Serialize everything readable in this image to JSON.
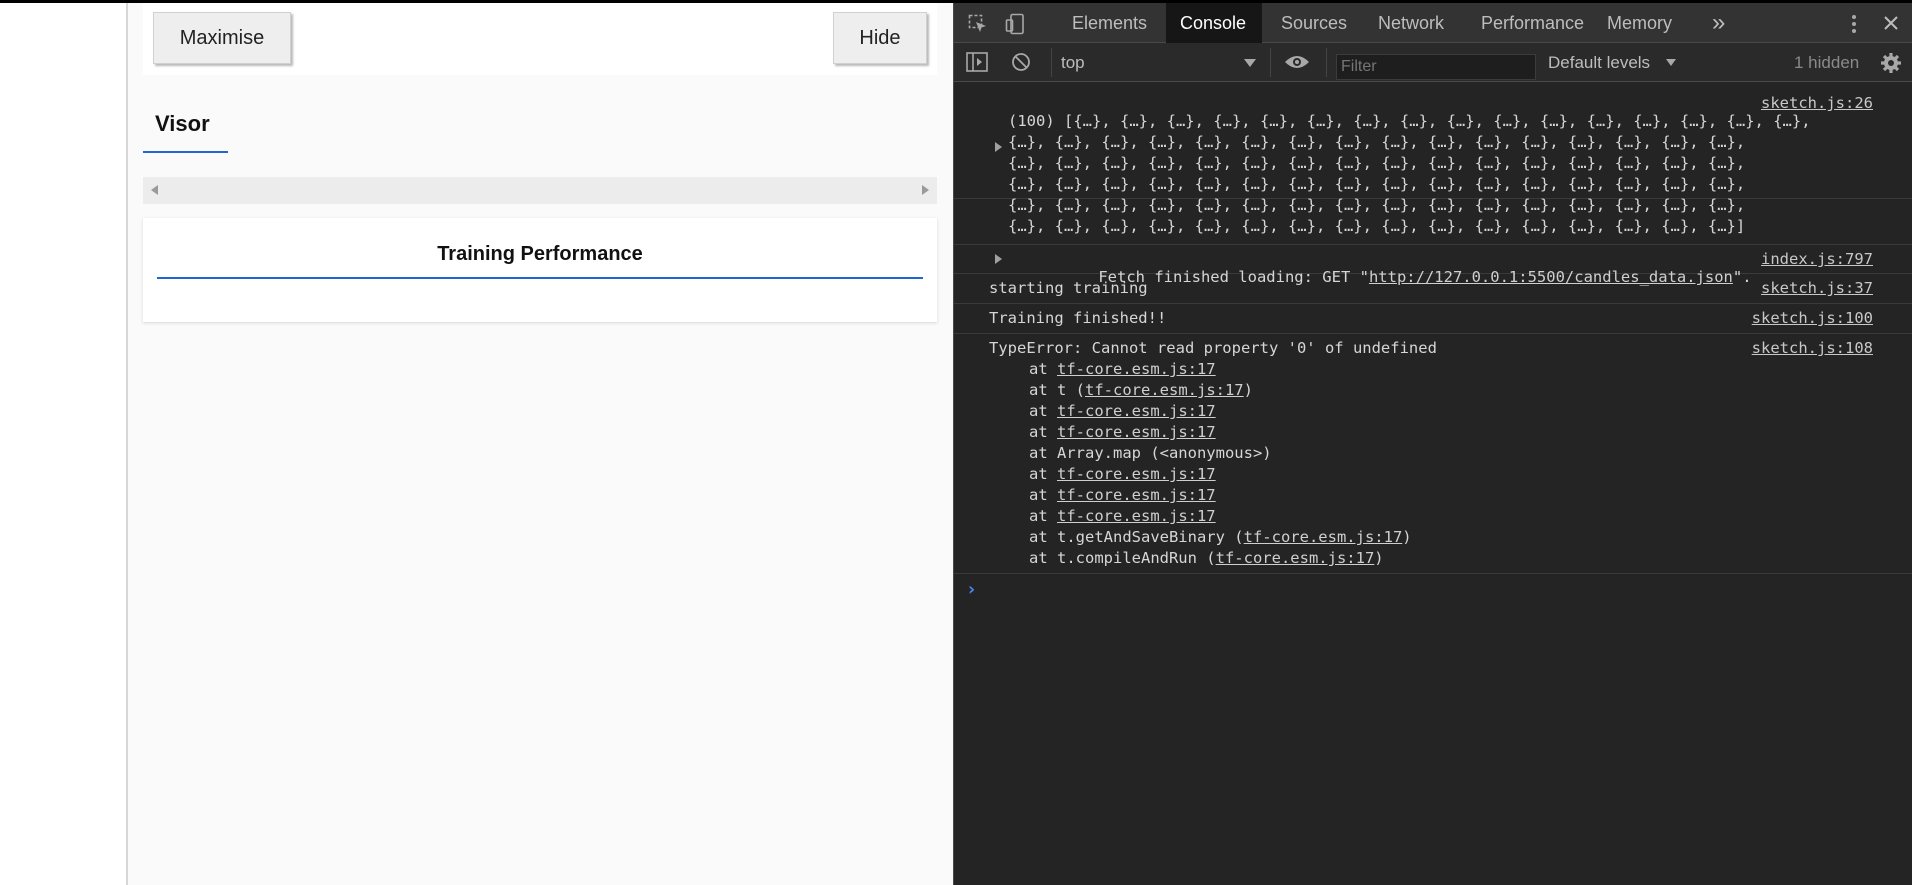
{
  "visor": {
    "maximise_label": "Maximise",
    "hide_label": "Hide",
    "tab_label": "Visor",
    "card_title": "Training Performance"
  },
  "devtools": {
    "tabs": [
      "Elements",
      "Console",
      "Sources",
      "Network",
      "Performance",
      "Memory"
    ],
    "overflow_glyph": "»",
    "toolbar": {
      "context": "top",
      "filter_placeholder": "Filter",
      "levels": "Default levels",
      "hidden": "1 hidden"
    },
    "console": {
      "array_lines": [
        "(100) [{…}, {…}, {…}, {…}, {…}, {…}, {…}, {…}, {…}, {…}, {…}, {…}, {…}, {…}, {…}, {…},",
        "{…}, {…}, {…}, {…}, {…}, {…}, {…}, {…}, {…}, {…}, {…}, {…}, {…}, {…}, {…}, {…},",
        "{…}, {…}, {…}, {…}, {…}, {…}, {…}, {…}, {…}, {…}, {…}, {…}, {…}, {…}, {…}, {…},",
        "{…}, {…}, {…}, {…}, {…}, {…}, {…}, {…}, {…}, {…}, {…}, {…}, {…}, {…}, {…}, {…},",
        "{…}, {…}, {…}, {…}, {…}, {…}, {…}, {…}, {…}, {…}, {…}, {…}, {…}, {…}, {…}, {…},",
        "{…}, {…}, {…}, {…}, {…}, {…}, {…}, {…}, {…}, {…}, {…}, {…}, {…}, {…}, {…}, {…}]"
      ],
      "array_source": "sketch.js:26",
      "fetch_prefix": "Fetch finished loading: GET \"",
      "fetch_url": "http://127.0.0.1:5500/candles_data.json",
      "fetch_suffix": "\".",
      "fetch_source": "index.js:797",
      "start_text": "starting training",
      "start_source": "sketch.js:37",
      "finish_text": "Training finished!!",
      "finish_source": "sketch.js:100",
      "error_text": "TypeError: Cannot read property '0' of undefined",
      "error_source": "sketch.js:108",
      "stack": [
        {
          "prefix": "at ",
          "link": "tf-core.esm.js:17",
          "suffix": ""
        },
        {
          "prefix": "at t (",
          "link": "tf-core.esm.js:17",
          "suffix": ")"
        },
        {
          "prefix": "at ",
          "link": "tf-core.esm.js:17",
          "suffix": ""
        },
        {
          "prefix": "at ",
          "link": "tf-core.esm.js:17",
          "suffix": ""
        },
        {
          "prefix": "at Array.map (<anonymous>)",
          "link": "",
          "suffix": ""
        },
        {
          "prefix": "at ",
          "link": "tf-core.esm.js:17",
          "suffix": ""
        },
        {
          "prefix": "at ",
          "link": "tf-core.esm.js:17",
          "suffix": ""
        },
        {
          "prefix": "at ",
          "link": "tf-core.esm.js:17",
          "suffix": ""
        },
        {
          "prefix": "at t.getAndSaveBinary (",
          "link": "tf-core.esm.js:17",
          "suffix": ")"
        },
        {
          "prefix": "at t.compileAndRun (",
          "link": "tf-core.esm.js:17",
          "suffix": ")"
        }
      ],
      "prompt_glyph": "›"
    }
  }
}
